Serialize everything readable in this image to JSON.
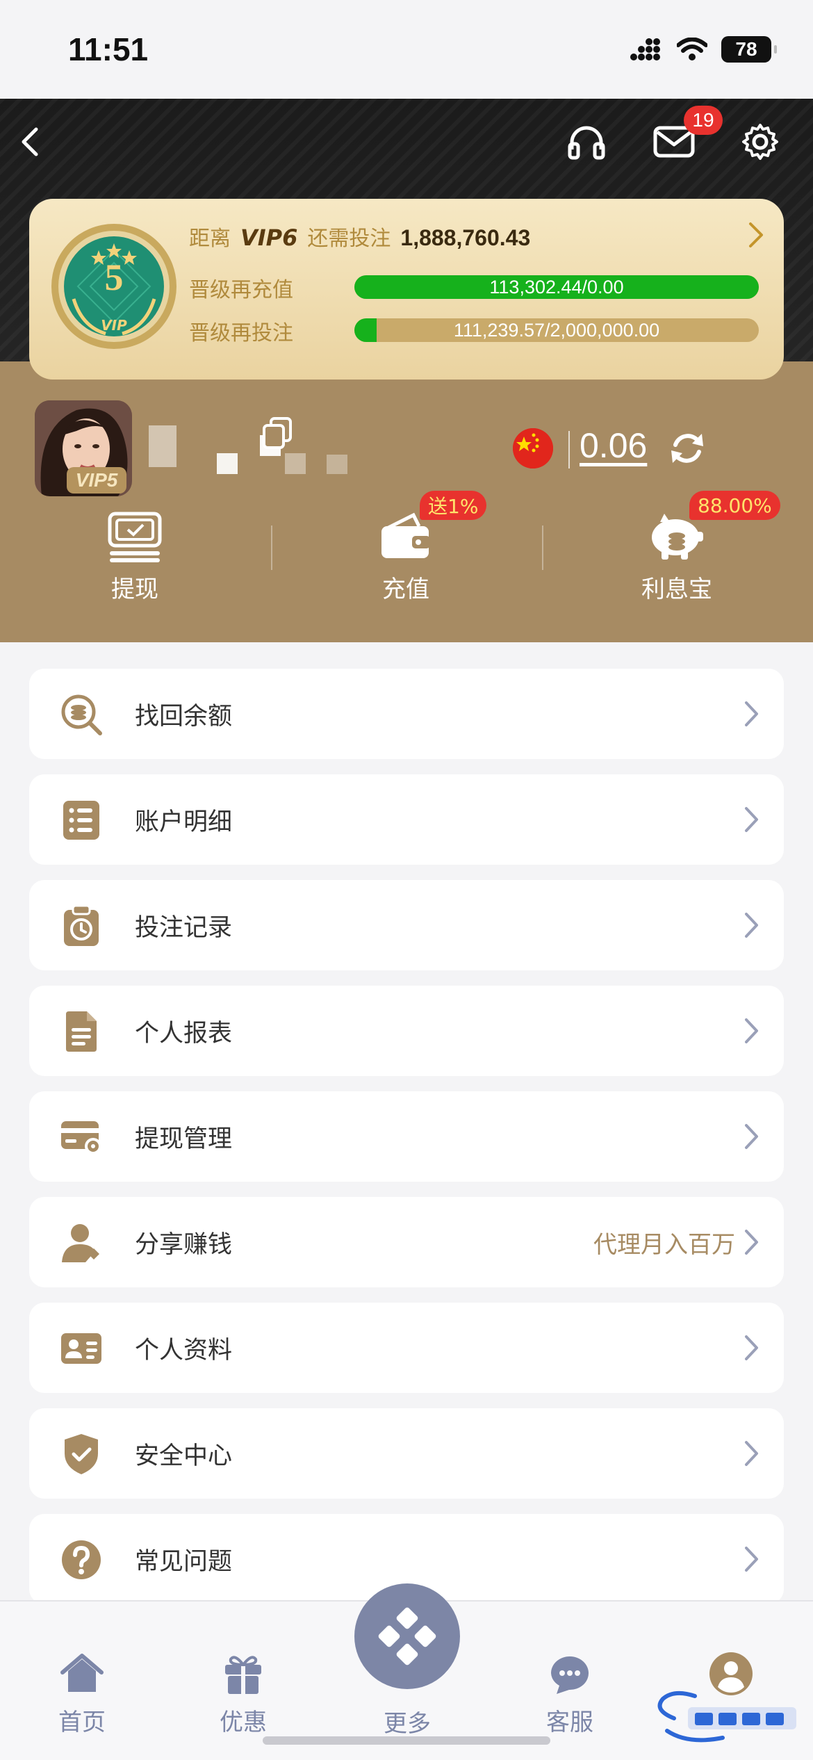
{
  "status_bar": {
    "time": "11:51",
    "battery": "78"
  },
  "header": {
    "mail_badge": "19"
  },
  "vip": {
    "prefix": "距离",
    "next_level": "VIP6",
    "needed_label": "还需投注",
    "needed_amount": "1,888,760.43",
    "current_level": "5",
    "medal_caption": "VIP",
    "recharge_label": "晋级再充值",
    "recharge_progress": "113,302.44/0.00",
    "recharge_fraction": 1.0,
    "bet_label": "晋级再投注",
    "bet_progress": "111,239.57/2,000,000.00",
    "bet_fraction": 0.0556
  },
  "profile": {
    "vip_tag": "VIP5",
    "balance": "0.06"
  },
  "quick_actions": [
    {
      "label": "提现",
      "icon": "withdraw-icon"
    },
    {
      "label": "充值",
      "icon": "wallet-icon",
      "badge": "送1%"
    },
    {
      "label": "利息宝",
      "icon": "piggy-bank-icon",
      "badge": "88.00%"
    }
  ],
  "menu": [
    {
      "label": "找回余额",
      "icon": "search-coins-icon"
    },
    {
      "label": "账户明细",
      "icon": "list-icon"
    },
    {
      "label": "投注记录",
      "icon": "clipboard-clock-icon"
    },
    {
      "label": "个人报表",
      "icon": "document-icon"
    },
    {
      "label": "提现管理",
      "icon": "card-settings-icon"
    },
    {
      "label": "分享赚钱",
      "icon": "user-share-icon",
      "extra": "代理月入百万"
    },
    {
      "label": "个人资料",
      "icon": "id-card-icon"
    },
    {
      "label": "安全中心",
      "icon": "shield-check-icon"
    },
    {
      "label": "常见问题",
      "icon": "help-icon"
    }
  ],
  "tabs": [
    {
      "label": "首页",
      "icon": "home-icon"
    },
    {
      "label": "优惠",
      "icon": "gift-icon"
    },
    {
      "label": "更多",
      "icon": "more-icon"
    },
    {
      "label": "客服",
      "icon": "support-chat-icon"
    },
    {
      "label": "我的",
      "icon": "profile-icon"
    }
  ],
  "colors": {
    "brand_brown": "#a78b63",
    "progress_green": "#16b11c",
    "badge_red": "#e8322e",
    "tab_inactive": "#7c86a8"
  }
}
